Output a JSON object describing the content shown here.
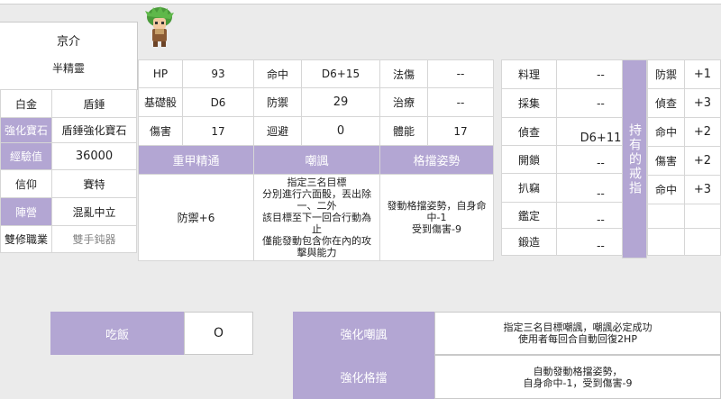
{
  "character": {
    "name": "京介",
    "race": "半精靈"
  },
  "profile": [
    {
      "label": "白金",
      "value": "盾錘",
      "label_style": "plain"
    },
    {
      "label": "強化寶石",
      "value": "盾錘強化寶石",
      "label_style": "accent"
    },
    {
      "label": "經驗值",
      "value": "36000",
      "label_style": "accent"
    },
    {
      "label": "信仰",
      "value": "賽特",
      "label_style": "plain"
    },
    {
      "label": "陣營",
      "value": "混亂中立",
      "label_style": "accent"
    },
    {
      "label": "雙修職業",
      "value": "雙手鈍器",
      "label_style": "plain"
    }
  ],
  "stats": {
    "rows": [
      [
        {
          "label": "HP",
          "value": "93"
        },
        {
          "label": "命中",
          "value": "D6+15"
        },
        {
          "label": "法傷",
          "value": "--"
        }
      ],
      [
        {
          "label": "基礎骰",
          "value": "D6"
        },
        {
          "label": "防禦",
          "value": "29"
        },
        {
          "label": "治療",
          "value": "--"
        }
      ],
      [
        {
          "label": "傷害",
          "value": "17"
        },
        {
          "label": "迴避",
          "value": "0"
        },
        {
          "label": "體能",
          "value": "17"
        }
      ]
    ]
  },
  "skills": {
    "headers": [
      "重甲精通",
      "嘲諷",
      "格擋姿勢"
    ],
    "descriptions": [
      "防禦+6",
      "指定三名目標\n分別進行六面骰，丟出除一、二外\n該目標至下一回合行動為止\n僅能發動包含你在內的攻擊與能力",
      "發動格擋姿勢，自身命中-1\n受到傷害-9"
    ]
  },
  "abilities": {
    "items": [
      {
        "label": "料理",
        "value": "--"
      },
      {
        "label": "採集",
        "value": "--"
      },
      {
        "label": "偵查",
        "value": "D6+11"
      },
      {
        "label": "開鎖",
        "value": "--"
      },
      {
        "label": "扒竊",
        "value": "--"
      },
      {
        "label": "鑑定",
        "value": "--"
      },
      {
        "label": "鍛造",
        "value": "--"
      }
    ]
  },
  "rings": {
    "title": "持有的戒指",
    "items": [
      {
        "label": "防禦",
        "value": "+1"
      },
      {
        "label": "偵查",
        "value": "+3"
      },
      {
        "label": "命中",
        "value": "+2"
      },
      {
        "label": "傷害",
        "value": "+2"
      },
      {
        "label": "命中",
        "value": "+3"
      }
    ]
  },
  "meal": {
    "label": "吃飯",
    "value": "O"
  },
  "enhancements": [
    {
      "label": "強化嘲諷",
      "desc": "指定三名目標嘲諷，嘲諷必定成功\n使用者每回合自動回復2HP"
    },
    {
      "label": "強化格擋",
      "desc": "自動發動格擋姿勢，\n自身命中-1，受到傷害-9"
    }
  ],
  "colors": {
    "accent": "#b3a6d3",
    "border": "#d6d6d6"
  },
  "avatar_icon": "character-sprite-icon"
}
